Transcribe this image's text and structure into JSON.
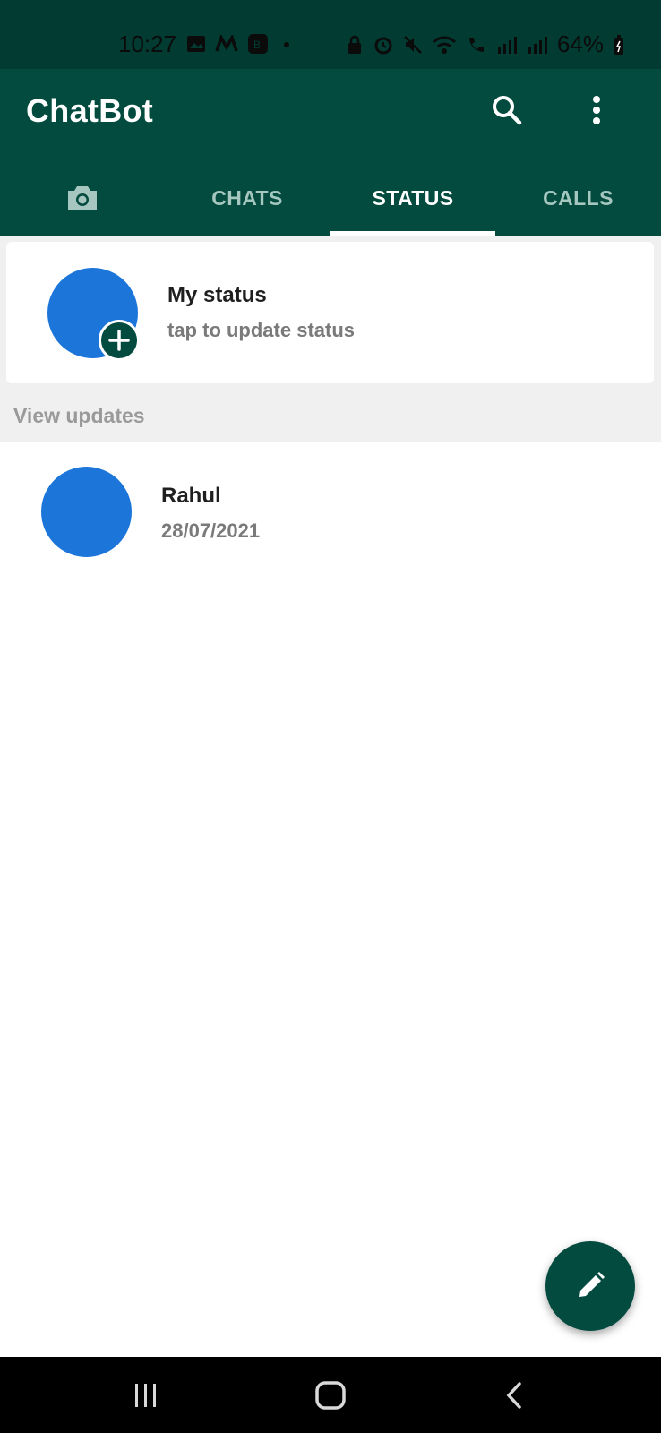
{
  "status_bar": {
    "time": "10:27",
    "battery": "64%",
    "left_icons": [
      "gallery-icon",
      "m-app-icon",
      "b-app-icon",
      "dot-icon"
    ],
    "right_icons": [
      "lock-icon",
      "alarm-icon",
      "mute-icon",
      "wifi-icon",
      "call-icon",
      "signal-icon",
      "signal-icon",
      "battery-icon"
    ]
  },
  "app_bar": {
    "title": "ChatBot",
    "search_icon": "search-icon",
    "more_icon": "more-vertical-icon",
    "colors": {
      "primary": "#034b3f",
      "status_bar": "#013b31"
    }
  },
  "tabs": [
    {
      "id": "camera",
      "icon": "camera-icon",
      "label": ""
    },
    {
      "id": "chats",
      "label": "CHATS"
    },
    {
      "id": "status",
      "label": "STATUS",
      "active": true
    },
    {
      "id": "calls",
      "label": "CALLS"
    }
  ],
  "my_status": {
    "title": "My status",
    "subtitle": "tap to update status",
    "avatar_color": "#1c76da",
    "badge_icon": "plus-icon"
  },
  "view_updates_label": "View updates",
  "updates": [
    {
      "name": "Rahul",
      "date": "28/07/2021",
      "avatar_color": "#1c76da"
    }
  ],
  "fab": {
    "icon": "pencil-icon"
  },
  "nav_bar": {
    "icons": [
      "recents-icon",
      "home-icon",
      "back-icon"
    ]
  }
}
